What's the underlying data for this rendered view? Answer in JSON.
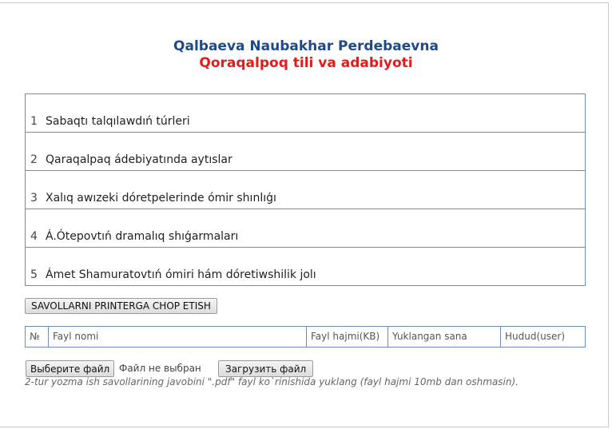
{
  "header": {
    "teacher_name": "Qalbaeva Naubakhar Perdebaevna",
    "subject": "Qoraqalpoq tili va adabiyoti"
  },
  "questions": [
    {
      "num": "1",
      "text": "Sabaqtı talqılawdıń túrleri"
    },
    {
      "num": "2",
      "text": "Qaraqalpaq ádebiyatında aytıslar"
    },
    {
      "num": "3",
      "text": "Xalıq awızeki dóretpelerinde  ómir shınlıǵı"
    },
    {
      "num": "4",
      "text": "Á.Ótepovtıń   dramalıq shıǵarmaları"
    },
    {
      "num": "5",
      "text": "Ámet Shamuratovtıń ómiri hám dóretiwshilik  jolı"
    }
  ],
  "print_button": "SAVOLLARNI PRINTERGA CHOP ETISH",
  "file_table": {
    "headers": [
      "№",
      "Fayl nomi",
      "Fayl hajmi(KB)",
      "Yuklangan sana",
      "Hudud(user)"
    ]
  },
  "upload": {
    "choose_label": "Выберите файл",
    "no_file_text": "Файл не выбран",
    "upload_label": "Загрузить файл",
    "hint": "2-tur yozma ish savollarining javobini \".pdf\" fayl ko`rinishida yuklang (fayl hajmi 10mb dan oshmasin)."
  }
}
